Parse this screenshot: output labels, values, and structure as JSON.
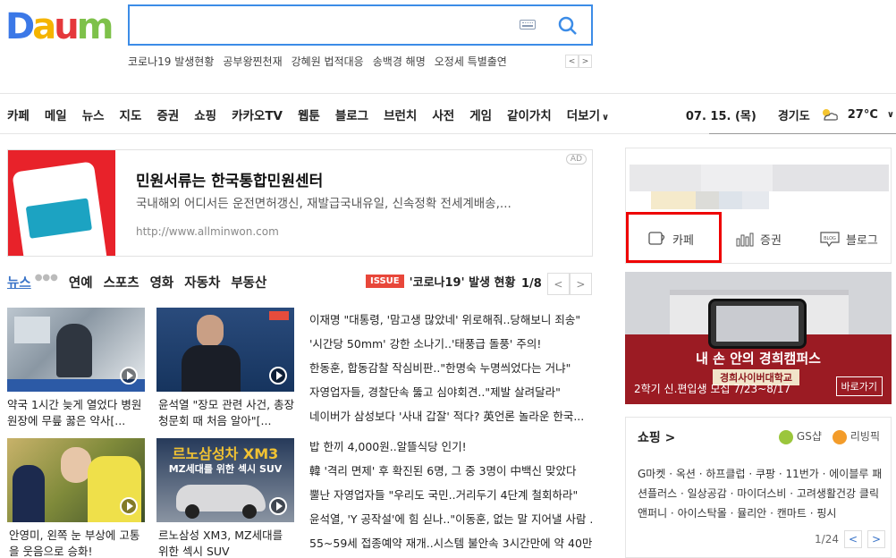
{
  "header": {
    "logo": "Daum",
    "search_placeholder": "",
    "trending": [
      "코로나19 발생현황",
      "공부왕찐천재",
      "강혜원 법적대응",
      "송백경 해명",
      "오정세 특별출연"
    ]
  },
  "gnb": {
    "items": [
      "카페",
      "메일",
      "뉴스",
      "지도",
      "증권",
      "쇼핑",
      "카카오TV",
      "웹툰",
      "블로그",
      "브런치",
      "사전",
      "게임",
      "같이가치",
      "더보기"
    ],
    "date": "07. 15. (목)",
    "region": "경기도",
    "temp": "27°C"
  },
  "ad": {
    "title": "민원서류는 한국통합민원센터",
    "desc": "국내해외 어디서든 운전면허갱신, 재발급국내유일, 신속정확 전세계배송,...",
    "url": "http://www.allminwon.com",
    "badge": "AD"
  },
  "news": {
    "tabs": [
      "뉴스",
      "연예",
      "스포츠",
      "영화",
      "자동차",
      "부동산"
    ],
    "issue_badge": "ISSUE",
    "issue_text": "'코로나19' 발생 현황",
    "page": "1/8",
    "thumbs": [
      {
        "caption": "약국 1시간 늦게 열었다 병원 원장에 무릎 꿇은 약사[..."
      },
      {
        "caption": "윤석열 \"장모 관련 사건, 총장 청문회 때 처음 알아\"[..."
      },
      {
        "caption": "안영미, 왼쪽 눈 부상에 고통을 웃음으로 승화!"
      },
      {
        "caption": "르노삼성 XM3, MZ세대를 위한 섹시 SUV"
      }
    ],
    "thumb_overlay": {
      "xm3_title": "르노삼성차 XM3",
      "xm3_sub": "MZ세대를 위한 섹시 SUV"
    },
    "headlines_1": [
      "이재명 \"대통령, '맘고생 많았네' 위로해줘..당해보니 죄송\"",
      "'시간당 50mm' 강한 소나기..'태풍급 돌풍' 주의!",
      "한동훈, 합동감찰 작심비판..\"한명숙 누명씌었다는 거냐\"",
      "자영업자들, 경찰단속 뚫고 심야회견..\"제발 살려달라\"",
      "네이버가 삼성보다 '사내 갑잘' 적다? 英언론 놀라운 한국..."
    ],
    "headlines_2": [
      "밥 한끼 4,000원..알뜰식당 인기!",
      "韓 '격리 면제' 후 확진된 6명, 그 중 3명이 中백신 맞았다",
      "뿔난 자영업자들 \"우리도 국민..거리두기 4단계 철회하라\"",
      "윤석열, 'Y 공작설'에 힘 싣나..\"이동훈, 없는 말 지어낼 사람 ...",
      "55~59세 접종예약 재개..시스템 불안속 3시간만에 약 40만..."
    ]
  },
  "right": {
    "services": [
      "카페",
      "증권",
      "블로그"
    ],
    "banner": {
      "title": "내 손 안의 경희캠퍼스",
      "sub": "경희사이버대학교",
      "info": "2학기 신.편입생 모집 7/23~8/17",
      "button": "바로가기"
    },
    "shopping": {
      "title": "쇼핑 >",
      "links": [
        "GS샵",
        "리빙픽"
      ],
      "list": "G마켓 · 옥션 · 하프클럽 · 쿠팡 · 11번가 · 에이블루 패션플러스 · 일상공감 · 마이더스비 · 고려생활건강 클릭앤퍼니 · 아이스탁몰 · 뮬리안 · 캔마트 · 핑시",
      "page": "1/24"
    }
  },
  "colors": {
    "accent": "#3c8ce7",
    "issue": "#e8473a",
    "banner_red": "#9b1b23",
    "highlight": "#ee0000"
  }
}
